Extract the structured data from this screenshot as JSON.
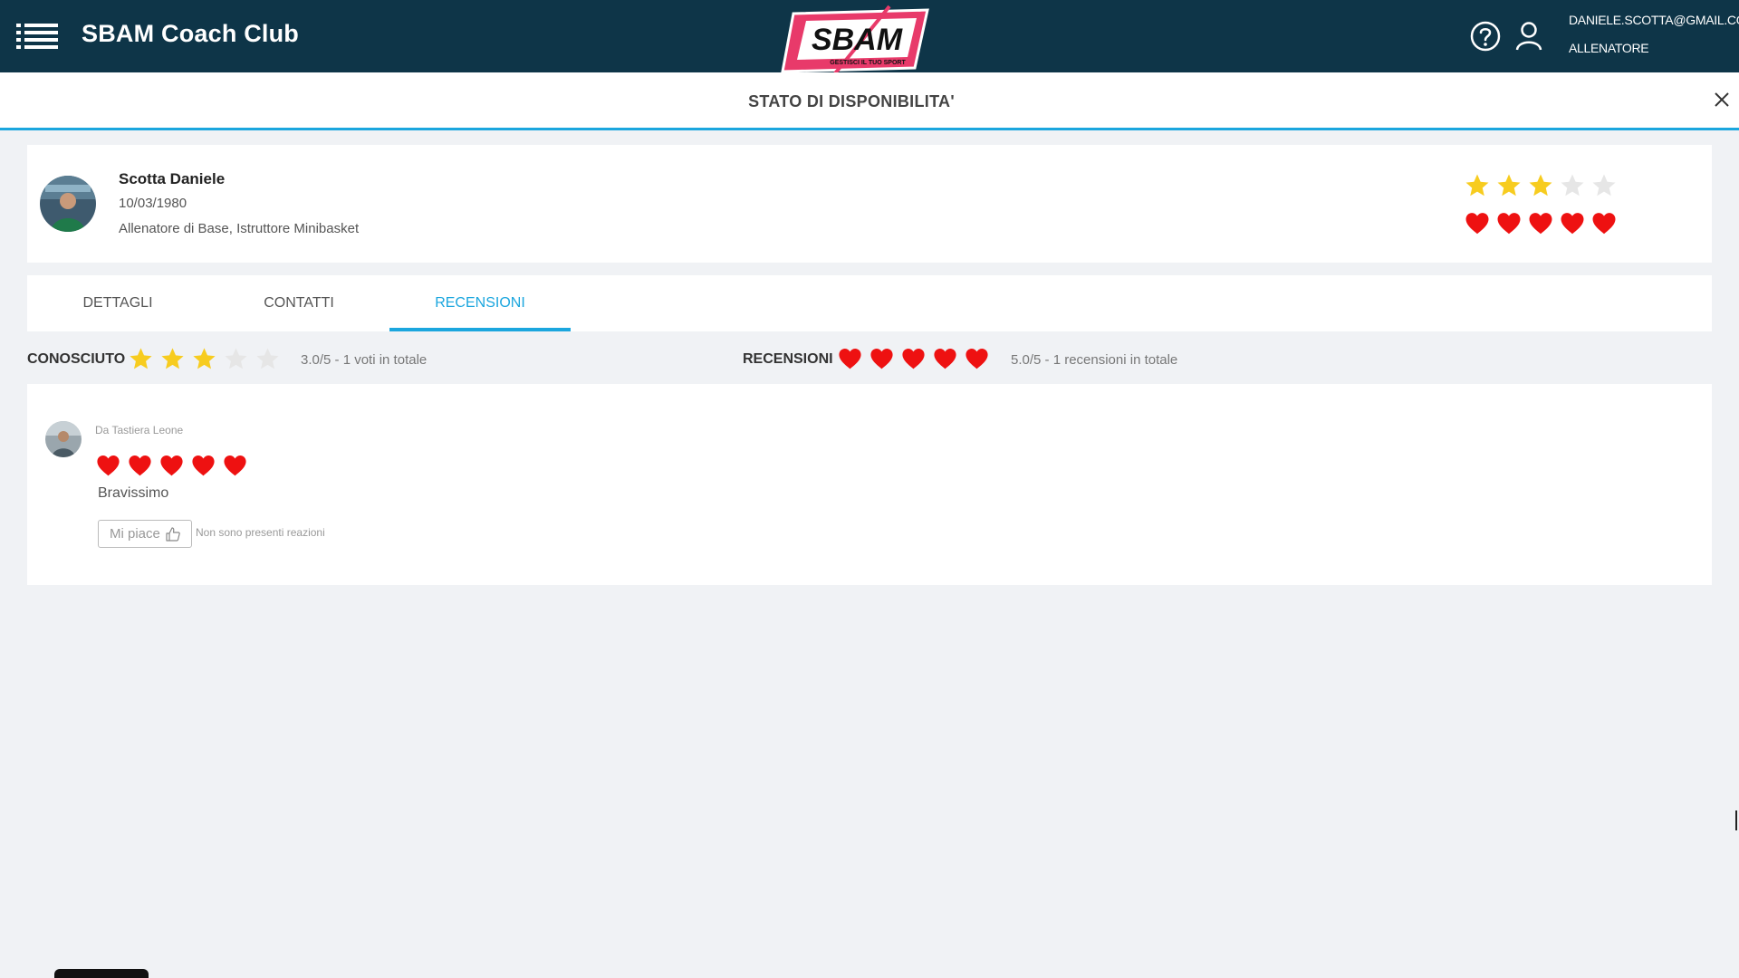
{
  "header": {
    "app_title": "SBAM Coach Club",
    "logo_text": "SBAM",
    "logo_tagline": "GESTISCI IL TUO SPORT",
    "user_email": "DANIELE.SCOTTA@GMAIL.COM",
    "user_role": "ALLENATORE"
  },
  "subheader": {
    "title": "STATO DI DISPONIBILITA'"
  },
  "profile": {
    "name": "Scotta Daniele",
    "birth_date": "10/03/1980",
    "role": "Allenatore di Base, Istruttore Minibasket",
    "stars_rating": 3,
    "hearts_rating": 5,
    "max_rating": 5
  },
  "tabs": [
    {
      "label": "DETTAGLI",
      "active": false
    },
    {
      "label": "CONTATTI",
      "active": false
    },
    {
      "label": "RECENSIONI",
      "active": true
    }
  ],
  "summary": {
    "known_label": "CONOSCIUTO",
    "known_rating": 3,
    "known_text": "3.0/5 - 1 voti in totale",
    "reviews_label": "RECENSIONI",
    "reviews_rating": 5,
    "reviews_text": "5.0/5 - 1 recensioni in totale"
  },
  "review": {
    "author": "Da Tastiera Leone",
    "rating": 5,
    "text": "Bravissimo",
    "like_label": "Mi piace",
    "reactions_text": "Non sono presenti reazioni"
  },
  "colors": {
    "header_bg": "#0e3548",
    "accent": "#1ba6de",
    "star_filled": "#f7cc1f",
    "star_empty": "#e6e6e6",
    "heart": "#ee1111",
    "logo_pink": "#e83a6a"
  },
  "icons": {
    "menu": "menu-icon",
    "help": "help-icon",
    "user": "user-icon",
    "close": "close-icon",
    "like": "thumbs-up-icon",
    "star": "star-icon",
    "heart": "heart-icon"
  }
}
